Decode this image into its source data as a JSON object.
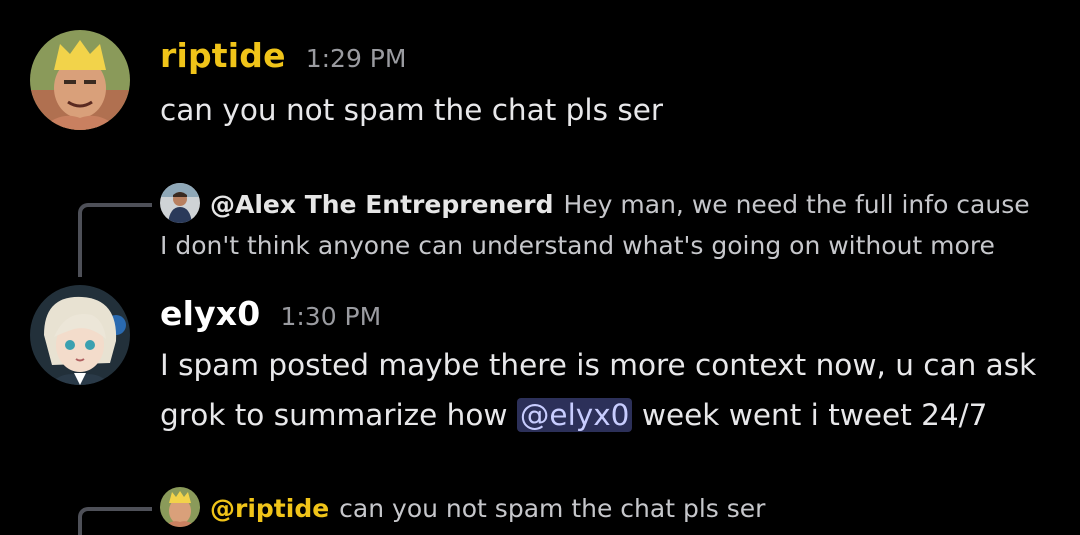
{
  "messages": [
    {
      "username": "riptide",
      "username_color": "#f0c419",
      "timestamp": "1:29 PM",
      "content": "can you not spam the chat pls ser"
    },
    {
      "reply": {
        "username": "@Alex The Entreprenerd",
        "username_color": "#e6e6e6",
        "text": "Hey man, we need the full info cause I don't think anyone can understand what's going on without more"
      },
      "username": "elyx0",
      "username_color": "#ffffff",
      "timestamp": "1:30 PM",
      "content_before": "I spam posted maybe there is more context now, u can ask grok to summarize how ",
      "mention": "@elyx0",
      "content_after": " week went i tweet 24/7"
    },
    {
      "reply": {
        "username": "@riptide",
        "username_color": "#f0c419",
        "text": "can you not spam the chat pls ser"
      }
    }
  ]
}
